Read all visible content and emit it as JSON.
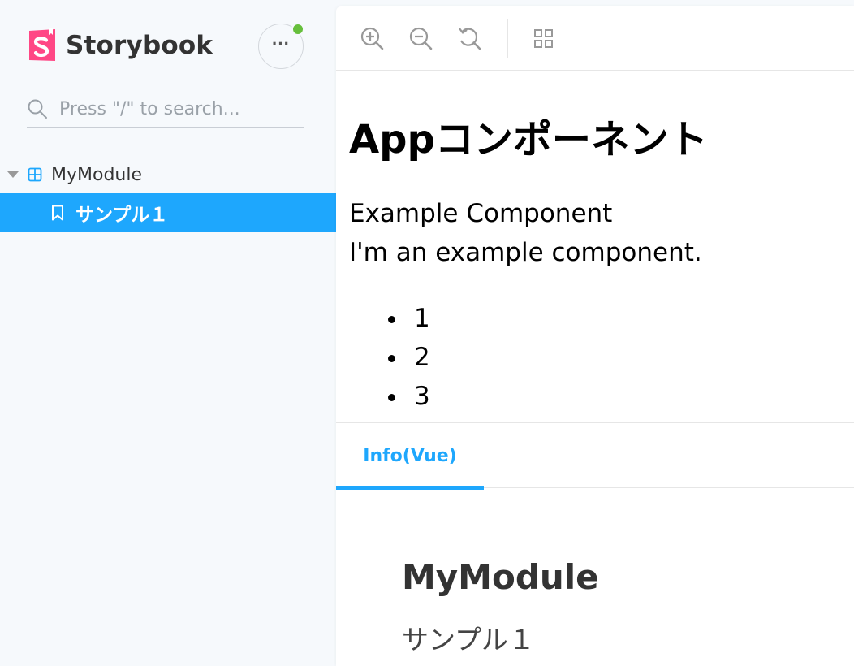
{
  "sidebar": {
    "brand": "Storybook",
    "search": {
      "placeholder": "Press \"/\" to search..."
    },
    "tree": {
      "group_label": "MyModule",
      "items": [
        {
          "label": "サンプル１",
          "selected": true
        }
      ]
    },
    "status_color": "#66bf3c"
  },
  "toolbar": {
    "icons": [
      "zoom-in-icon",
      "zoom-out-icon",
      "reset-zoom-icon",
      "grid-icon"
    ]
  },
  "preview": {
    "heading": "Appコンポーネント",
    "lines": [
      "Example Component",
      "I'm an example component."
    ],
    "list": [
      "1",
      "2",
      "3"
    ]
  },
  "addons": {
    "tabs": [
      {
        "label": "Info(Vue)",
        "active": true
      }
    ],
    "info": {
      "title": "MyModule",
      "subtitle": "サンプル１"
    }
  },
  "colors": {
    "accent": "#1ea7fd",
    "brand": "#ff4785",
    "sidebar_bg": "#f6f9fc",
    "text": "#333333"
  }
}
